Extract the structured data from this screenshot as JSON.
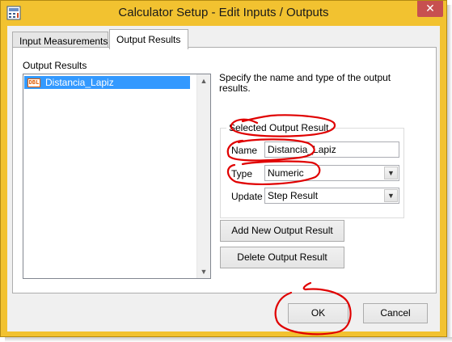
{
  "window": {
    "title": "Calculator Setup - Edit Inputs / Outputs",
    "close_glyph": "✕"
  },
  "tabs": [
    {
      "label": "Input Measurements",
      "active": false
    },
    {
      "label": "Output Results",
      "active": true
    }
  ],
  "output_list": {
    "label": "Output Results",
    "items": [
      {
        "type_badge": "DBL",
        "label": "Distancia_Lapiz",
        "selected": true
      }
    ]
  },
  "description": "Specify the name and type of the output results.",
  "selected_output": {
    "group_title": "Selected Output Result",
    "name_label": "Name",
    "name_value": "Distancia_Lapiz",
    "type_label": "Type",
    "type_value": "Numeric",
    "update_label": "Update",
    "update_value": "Step Result"
  },
  "buttons": {
    "add": "Add New Output Result",
    "delete": "Delete Output Result",
    "ok": "OK",
    "cancel": "Cancel"
  },
  "colors": {
    "frame": "#f2c230",
    "selection": "#3399ff",
    "annotation": "#e00000",
    "close_button": "#c75050"
  }
}
